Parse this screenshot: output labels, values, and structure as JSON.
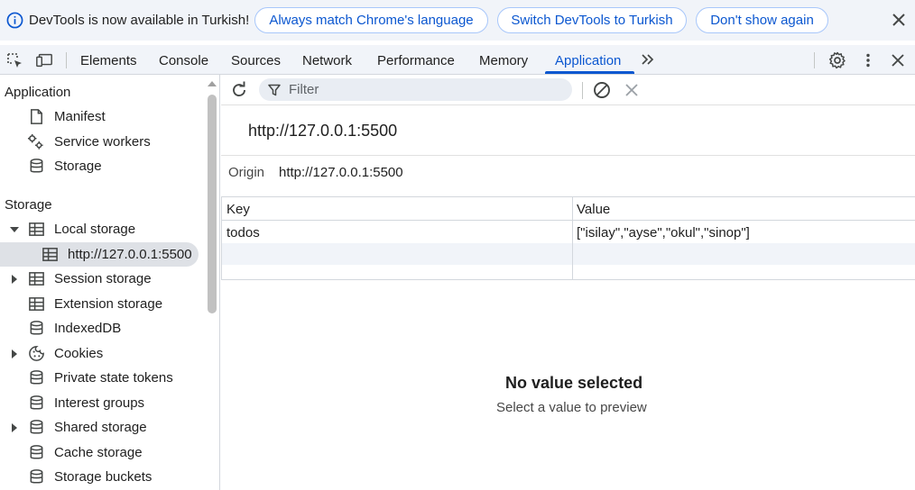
{
  "infobar": {
    "message": "DevTools is now available in Turkish!",
    "buttons": [
      "Always match Chrome's language",
      "Switch DevTools to Turkish",
      "Don't show again"
    ]
  },
  "tabs": [
    "Elements",
    "Console",
    "Sources",
    "Network",
    "Performance",
    "Memory",
    "Application"
  ],
  "active_tab": "Application",
  "sidebar": {
    "application_header": "Application",
    "application_items": [
      "Manifest",
      "Service workers",
      "Storage"
    ],
    "storage_header": "Storage",
    "storage_items": [
      {
        "label": "Local storage",
        "expanded": true
      },
      {
        "label": "http://127.0.0.1:5500",
        "selected": true
      },
      {
        "label": "Session storage",
        "expandable": true
      },
      {
        "label": "Extension storage"
      },
      {
        "label": "IndexedDB"
      },
      {
        "label": "Cookies",
        "expandable": true
      },
      {
        "label": "Private state tokens"
      },
      {
        "label": "Interest groups"
      },
      {
        "label": "Shared storage",
        "expandable": true
      },
      {
        "label": "Cache storage"
      },
      {
        "label": "Storage buckets"
      }
    ]
  },
  "toolbar": {
    "filter_placeholder": "Filter"
  },
  "main": {
    "origin_title": "http://127.0.0.1:5500",
    "origin_label": "Origin",
    "origin_value": "http://127.0.0.1:5500",
    "table": {
      "headers": [
        "Key",
        "Value"
      ],
      "rows": [
        [
          "todos",
          "[\"isilay\",\"ayse\",\"okul\",\"sinop\"]"
        ]
      ]
    },
    "empty_title": "No value selected",
    "empty_subtitle": "Select a value to preview"
  },
  "colors": {
    "accent": "#0b57d0",
    "bar_bg": "#f1f4f9"
  }
}
